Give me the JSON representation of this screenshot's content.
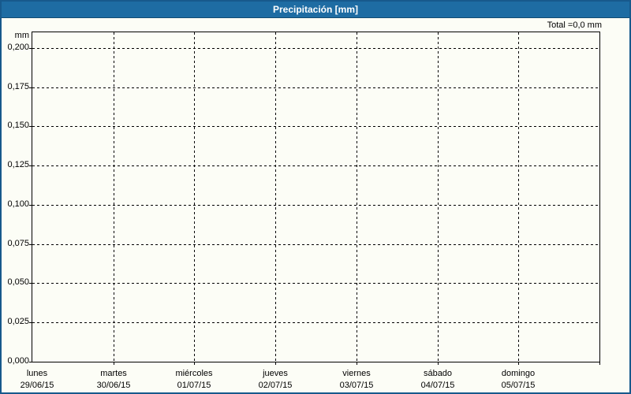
{
  "chart_data": {
    "type": "bar",
    "title": "Precipitación [mm]",
    "total_label": "Total =0,0 mm",
    "ylabel": "mm",
    "ylim": [
      0,
      0.21
    ],
    "grid": "dashed-black",
    "legend": "none",
    "y_ticks": [
      {
        "label": "0,000",
        "value": 0
      },
      {
        "label": "0,025",
        "value": 0.025
      },
      {
        "label": "0,050",
        "value": 0.05
      },
      {
        "label": "0,075",
        "value": 0.075
      },
      {
        "label": "0,100",
        "value": 0.1
      },
      {
        "label": "0,125",
        "value": 0.125
      },
      {
        "label": "0,150",
        "value": 0.15
      },
      {
        "label": "0,175",
        "value": 0.175
      },
      {
        "label": "0,200",
        "value": 0.2
      }
    ],
    "categories": [
      "lunes",
      "martes",
      "miércoles",
      "jueves",
      "viernes",
      "sábado",
      "domingo"
    ],
    "dates": [
      "29/06/15",
      "30/06/15",
      "01/07/15",
      "02/07/15",
      "03/07/15",
      "04/07/15",
      "05/07/15"
    ],
    "values": [
      0,
      0,
      0,
      0,
      0,
      0,
      0
    ]
  },
  "colors": {
    "header_bg": "#1E6CA3",
    "header_text": "#FFFFFF",
    "frame_border": "#17598C",
    "canvas_bg": "#FCFDF6",
    "grid": "#000000",
    "bar": "#1E6CA3"
  }
}
